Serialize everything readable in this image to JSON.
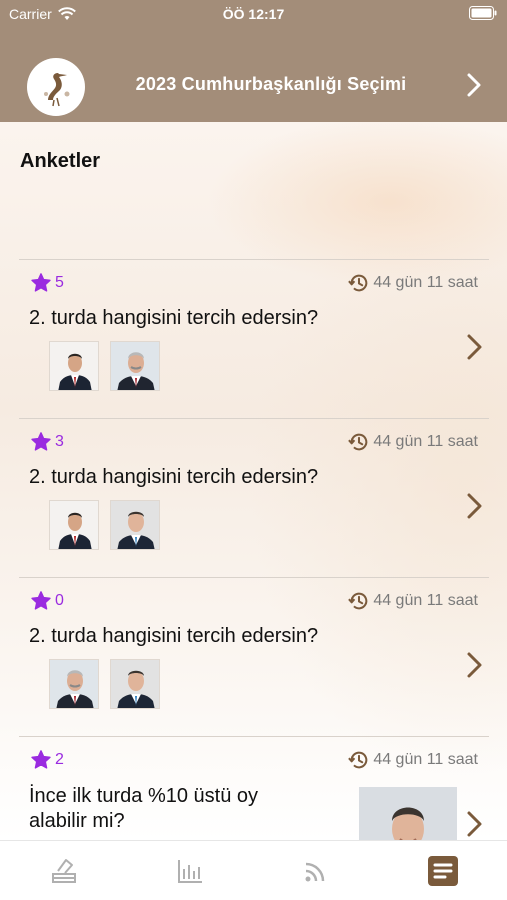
{
  "status": {
    "carrier": "Carrier",
    "time": "ÖÖ 12:17"
  },
  "nav": {
    "title": "2023 Cumhurbaşkanlığı Seçimi"
  },
  "page": {
    "title": "Anketler"
  },
  "polls": [
    {
      "stars": "5",
      "remaining": "44 gün 11 saat",
      "question": "2. turda hangisini tercih edersin?"
    },
    {
      "stars": "3",
      "remaining": "44 gün 11 saat",
      "question": "2. turda hangisini tercih edersin?"
    },
    {
      "stars": "0",
      "remaining": "44 gün 11 saat",
      "question": "2. turda hangisini tercih edersin?"
    },
    {
      "stars": "2",
      "remaining": "44 gün 11 saat",
      "question": "İnce ilk turda %10 üstü oy alabilir mi?"
    }
  ],
  "colors": {
    "header": "#a38d79",
    "accent": "#9a2be0",
    "chevron": "#7a5a3b",
    "activeTab": "#7a5a3b"
  },
  "tabs": [
    {
      "icon": "ballot-box-icon",
      "active": false
    },
    {
      "icon": "bar-chart-icon",
      "active": false
    },
    {
      "icon": "rss-icon",
      "active": false
    },
    {
      "icon": "document-icon",
      "active": true
    }
  ]
}
